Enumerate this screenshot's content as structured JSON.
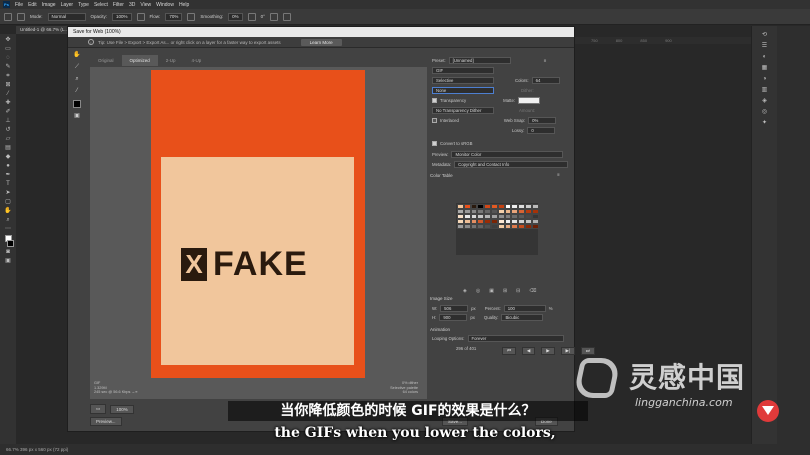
{
  "app": {
    "menu": [
      "File",
      "Edit",
      "Image",
      "Layer",
      "Type",
      "Select",
      "Filter",
      "3D",
      "View",
      "Window",
      "Help"
    ],
    "ps_logo": "Ps",
    "doc_tab": "Untitled-1 @ 66.7% (L...",
    "status_bar": "66.7%    396 px x 560 px (72 ppi)"
  },
  "options_bar": {
    "mode_label": "Mode:",
    "mode_value": "Normal",
    "opacity_label": "Opacity:",
    "opacity_value": "100%",
    "flow_label": "Flow:",
    "flow_value": "70%",
    "smoothing_label": "Smoothing:",
    "smoothing_value": "0%",
    "angle_value": "0°"
  },
  "ruler": [
    "750",
    "800",
    "850",
    "900"
  ],
  "dialog": {
    "title": "Save for Web (100%)",
    "tip_icon": "info-icon",
    "tip_text": "Tip: Use File > Export > Export As...  or right click on a layer for a faster way to export assets",
    "learn_more": "Learn More",
    "tabs": [
      "Original",
      "Optimized",
      "2-Up",
      "4-Up"
    ],
    "active_tab": "Optimized",
    "image_logo_mark": "X",
    "image_logo_text": "FAKE",
    "info_left": [
      "GIF",
      "1.329M",
      "245 sec @ 56.6 Kbps  →≡"
    ],
    "info_right": [
      "0% dither",
      "Selective palette",
      "64 colors"
    ],
    "zoom_value": "100%",
    "preview_button": "Preview...",
    "save_button": "Save...",
    "done_button": "Done"
  },
  "settings": {
    "preset_label": "Preset:",
    "preset_value": "[Unnamed]",
    "format": "GIF",
    "reduction": "Selective",
    "colors_label": "Colors:",
    "colors_value": "64",
    "dither_method": "None",
    "dither_label": "Dither:",
    "transparency_label": "Transparency",
    "matte_label": "Matte:",
    "transparency_dither": "No Transparency Dither",
    "amount_label": "Amount:",
    "interlaced_label": "Interlaced",
    "web_snap_label": "Web Snap:",
    "web_snap_value": "0%",
    "lossy_label": "Lossy:",
    "lossy_value": "0",
    "convert_srgb_label": "Convert to sRGB",
    "preview_label": "Preview:",
    "preview_value": "Monitor Color",
    "metadata_label": "Metadata:",
    "metadata_value": "Copyright and Contact Info",
    "color_table_label": "Color Table",
    "image_size_label": "Image Size",
    "w_label": "W:",
    "w_value": "506",
    "w_unit": "px",
    "h_label": "H:",
    "h_value": "900",
    "h_unit": "px",
    "percent_label": "Percent:",
    "percent_value": "100",
    "percent_unit": "%",
    "quality_label": "Quality:",
    "quality_value": "Bicubic",
    "animation_label": "Animation",
    "looping_label": "Looping Options:",
    "looping_value": "Forever",
    "frame_counter": "296 of 401"
  },
  "color_table": [
    "#f1c69c",
    "#e8501a",
    "#2a1a0e",
    "#000000",
    "#d04818",
    "#e25a22",
    "#c44010",
    "#ffffff",
    "#eeeeee",
    "#dddddd",
    "#cccccc",
    "#bbbbbb",
    "#aaaaaa",
    "#999999",
    "#888888",
    "#777777",
    "#666666",
    "#555555",
    "#f4d0aa",
    "#ecb88c",
    "#e9a47a",
    "#d86434",
    "#b83a0c",
    "#a63208",
    "#f8e0c8",
    "#eaeaea",
    "#d8d8d8",
    "#c6c6c6",
    "#b4b4b4",
    "#a2a2a2",
    "#909090",
    "#7e7e7e",
    "#6c6c6c",
    "#5a5a5a",
    "#484848",
    "#363636",
    "#f6d8b8",
    "#eebe96",
    "#e48e62",
    "#d2582a",
    "#9a2c06",
    "#7a2404",
    "#fce8d4",
    "#f0f0f0",
    "#e4e4e4",
    "#d4d4d4",
    "#c4c4c4",
    "#b0b0b0",
    "#9c9c9c",
    "#8a8a8a",
    "#747474",
    "#626262",
    "#505050",
    "#3e3e3e",
    "#f3cba3",
    "#e6ab83",
    "#dc7a4c",
    "#c84c1c",
    "#8a2806",
    "#6a1e04"
  ],
  "subtitles": {
    "chinese": "当你降低颜色的时候 GIF的效果是什么？",
    "english": "the GIFs when you lower the colors,"
  },
  "watermark": {
    "chinese": "灵感中国",
    "url": "lingganchina.com"
  }
}
